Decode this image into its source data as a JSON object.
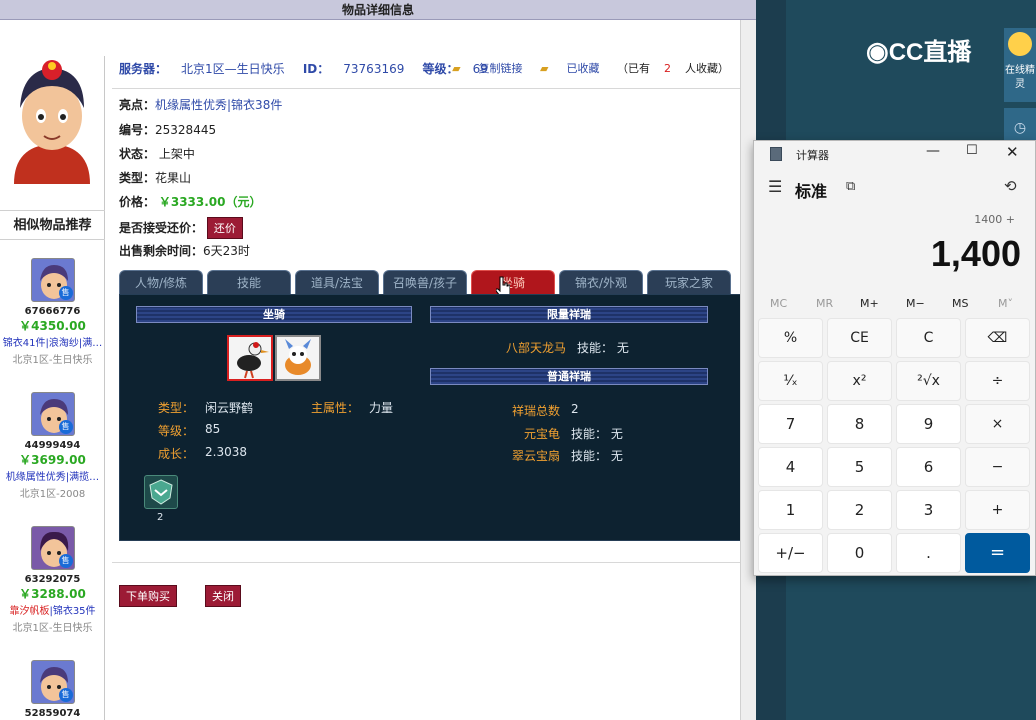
{
  "window_title": "物品详细信息",
  "headline": {
    "server_label": "服务器：",
    "server_value": "北京1区—生日快乐",
    "id_label": "ID：",
    "id_value": "73763169",
    "level_label": "等级：",
    "level_value": "69",
    "copy_link": "复制链接",
    "favorited": "已收藏",
    "fav_count_text_pre": "（已有",
    "fav_count": "2",
    "fav_count_text_post": "人收藏）"
  },
  "info": {
    "highlight_label": "亮点：",
    "highlight_value": "机缘属性优秀|锦衣38件",
    "number_label": "编号：",
    "number_value": "25328445",
    "status_label": "状态：",
    "status_value": "上架中",
    "type_label": "类型：",
    "type_value": "花果山",
    "price_label": "价格：",
    "price_value": "￥3333.00（元）",
    "bargain_label": "是否接受还价：",
    "bargain_button": "还价",
    "time_label": "出售剩余时间：",
    "time_value": "6天23时"
  },
  "sidebar": {
    "title": "相似物品推荐",
    "items": [
      {
        "id": "67666776",
        "price": "￥4350.00",
        "desc": "锦衣41件|浪淘纱|满…",
        "server": "北京1区-生日快乐",
        "desc_red": false
      },
      {
        "id": "44999494",
        "price": "￥3699.00",
        "desc": "机缘属性优秀|满揽…",
        "server": "北京1区-2008",
        "desc_red": false
      },
      {
        "id": "63292075",
        "price": "￥3288.00",
        "desc_red_part": "靠汐帆板",
        "desc": "|锦衣35件",
        "server": "北京1区-生日快乐",
        "desc_red": true
      },
      {
        "id": "52859074",
        "price": "",
        "desc": "",
        "server": "",
        "desc_red": false
      }
    ],
    "sell_badge": "售"
  },
  "tabs": [
    {
      "label": "人物/修炼",
      "active": false
    },
    {
      "label": "技能",
      "active": false
    },
    {
      "label": "道具/法宝",
      "active": false
    },
    {
      "label": "召唤兽/孩子",
      "active": false
    },
    {
      "label": "坐骑",
      "active": true
    },
    {
      "label": "锦衣/外观",
      "active": false
    },
    {
      "label": "玩家之家",
      "active": false
    }
  ],
  "mount_panel": {
    "mount_header": "坐骑",
    "limited_header": "限量祥瑞",
    "normal_header": "普通祥瑞",
    "type_label": "类型：",
    "type_value": "闲云野鹤",
    "main_attr_label": "主属性：",
    "main_attr_value": "力量",
    "level_label": "等级：",
    "level_value": "85",
    "growth_label": "成长：",
    "growth_value": "2.3038",
    "limited_name": "八部天龙马",
    "skill_label": "技能：",
    "skill_none": "无",
    "total_label": "祥瑞总数",
    "total_value": "2",
    "normal_items": [
      "元宝龟",
      "翠云宝扇"
    ],
    "badge_count": "2"
  },
  "buttons": {
    "buy": "下单购买",
    "close": "关闭"
  },
  "cc": {
    "logo_text": "CC直播",
    "side1": "在线精灵"
  },
  "calculator": {
    "title": "计算器",
    "mode": "标准",
    "expression": "1400 +",
    "display": "1,400",
    "memory": [
      "MC",
      "MR",
      "M+",
      "M−",
      "MS",
      "M˅"
    ],
    "keys": [
      [
        "%",
        "CE",
        "C",
        "⌫"
      ],
      [
        "¹⁄ₓ",
        "x²",
        "²√x",
        "÷"
      ],
      [
        "7",
        "8",
        "9",
        "×"
      ],
      [
        "4",
        "5",
        "6",
        "−"
      ],
      [
        "1",
        "2",
        "3",
        "+"
      ],
      [
        "+/−",
        "0",
        ".",
        "="
      ]
    ]
  }
}
